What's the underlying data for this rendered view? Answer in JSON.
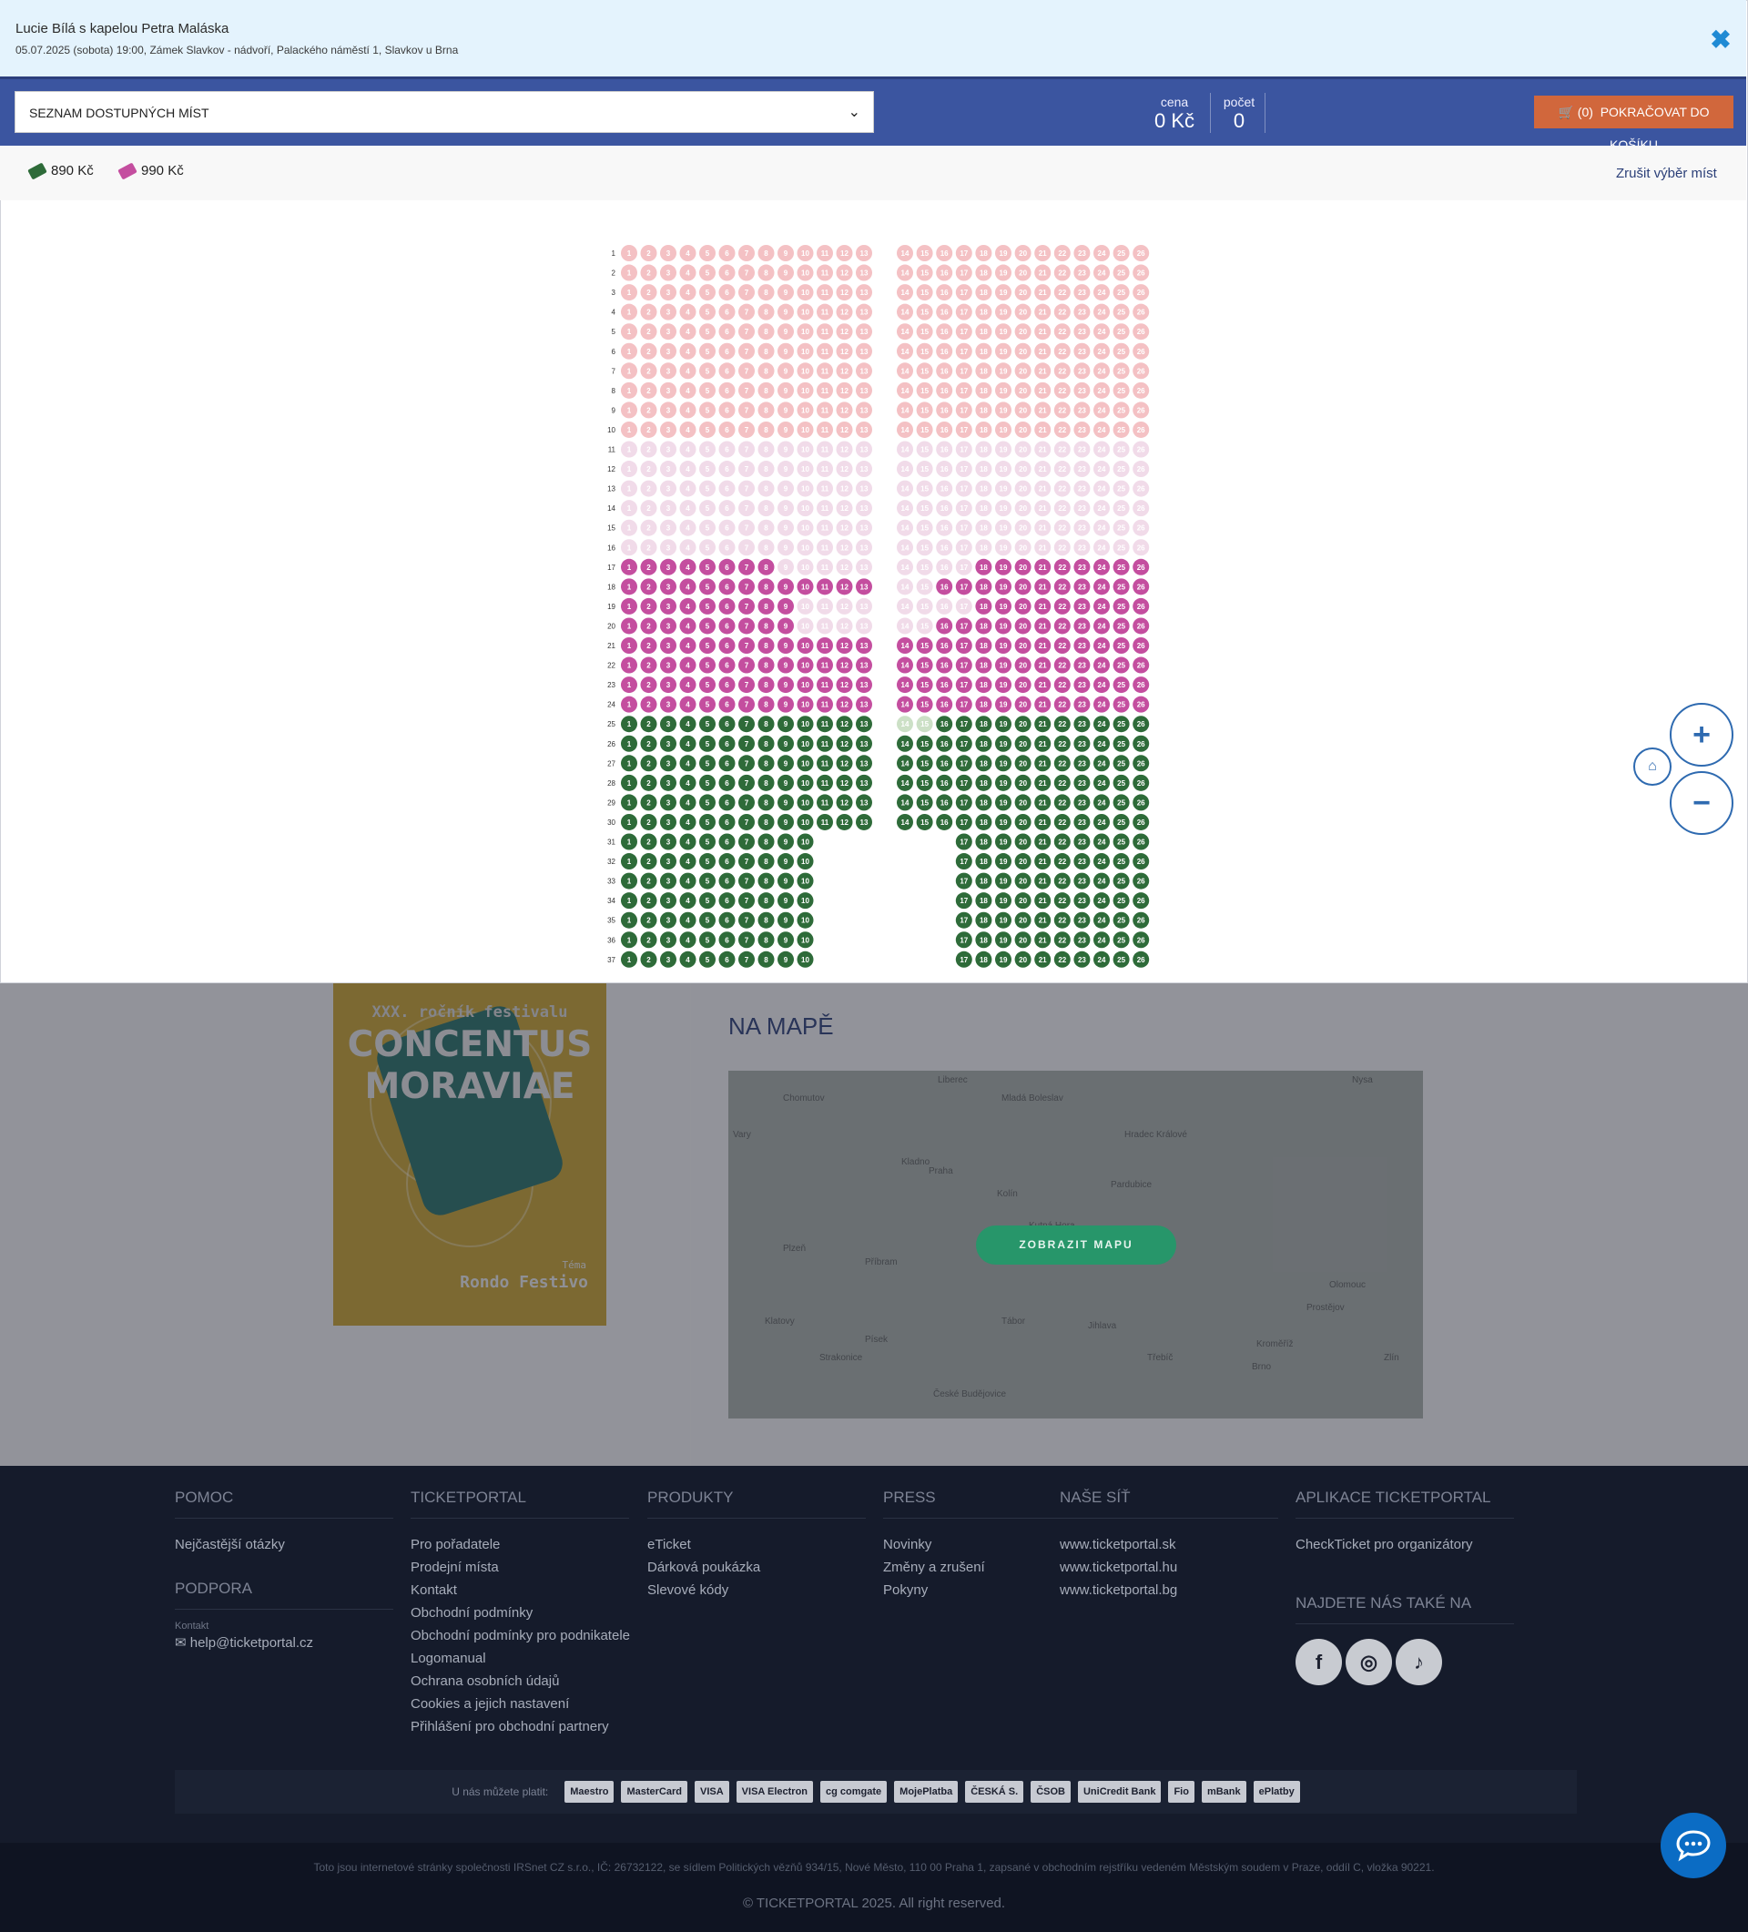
{
  "event": {
    "title": "Lucie Bílá s kapelou Petra Maláska",
    "subtitle": "05.07.2025 (sobota) 19:00, Zámek Slavkov - nádvoří, Palackého náměstí 1, Slavkov u Brna",
    "close_icon": "close-icon"
  },
  "toolbar": {
    "select_value": "SEZNAM DOSTUPNÝCH MÍST",
    "price_label": "cena",
    "price_value": "0 Kč",
    "count_label": "počet",
    "count_value": "0",
    "cart_count": "(0)",
    "cart_label": "POKRAČOVAT DO KOŠÍKU"
  },
  "legend": {
    "items": [
      {
        "label": "890 Kč",
        "color": "#2e6b39"
      },
      {
        "label": "990 Kč",
        "color": "#c44e9f"
      }
    ],
    "cancel_label": "Zrušit výběr míst"
  },
  "seat_map": {
    "rows": 37,
    "colors": {
      "sold_pink": "#f4c1c4",
      "sold_light": "#f1dbe9",
      "available_990": "#c44e9f",
      "available_890": "#2e6b39",
      "sold_green": "#cce0c6"
    }
  },
  "poster": {
    "line1": "XXX. ročník festivalu",
    "line2": "CONCENTUS",
    "line3": "MORAVIAE",
    "line4": "Téma",
    "line5": "Rondo Festivo"
  },
  "map": {
    "title": "NA MAPĚ",
    "button": "ZOBRAZIT MAPU",
    "places": [
      "Praha",
      "Plzeň",
      "Brno",
      "Mladá Boleslav",
      "Hradec Králové",
      "Pardubice",
      "Kolín",
      "Příbram",
      "Tábor",
      "Jihlava",
      "Písek",
      "Klatovy",
      "Olomouc",
      "Prostějov",
      "Třebíč",
      "Kutná Hora",
      "Kladno",
      "Liberec",
      "Nysa",
      "Chomutov",
      "Vary",
      "Strakonice",
      "České Budějovice",
      "Kroměříž",
      "Zlín"
    ]
  },
  "footer": {
    "columns": [
      {
        "heading": "POMOC",
        "links": [
          "Nejčastější otázky"
        ]
      },
      {
        "heading": "TICKETPORTAL",
        "links": [
          "Pro pořadatele",
          "Prodejní místa",
          "Kontakt",
          "Obchodní podmínky",
          "Obchodní podmínky pro podnikatele",
          "Logomanual",
          "Ochrana osobních údajů",
          "Cookies a jejich nastavení",
          "Přihlášení pro obchodní partnery"
        ]
      },
      {
        "heading": "PRODUKTY",
        "links": [
          "eTicket",
          "Dárková poukázka",
          "Slevové kódy"
        ]
      },
      {
        "heading": "PRESS",
        "links": [
          "Novinky",
          "Změny a zrušení",
          "Pokyny"
        ]
      },
      {
        "heading": "NAŠE SÍŤ",
        "links": [
          "www.ticketportal.sk",
          "www.ticketportal.hu",
          "www.ticketportal.bg"
        ]
      },
      {
        "heading": "APLIKACE TICKETPORTAL",
        "links": [
          "CheckTicket pro organizátory"
        ]
      }
    ],
    "support_heading": "PODPORA",
    "contact_label": "Kontakt",
    "contact_email": "help@ticketportal.cz",
    "social_heading": "NAJDETE NÁS TAKÉ NA",
    "social": [
      "f",
      "◎",
      "♪"
    ],
    "pay_label": "U nás můžete platit:",
    "payments": [
      "Maestro",
      "MasterCard",
      "VISA",
      "VISA Electron",
      "cg comgate",
      "MojePlatba",
      "ČESKÁ S.",
      "ČSOB",
      "UniCredit Bank",
      "Fio",
      "mBank",
      "ePlatby"
    ],
    "legal": "Toto jsou internetové stránky společnosti IRSnet CZ s.r.o., IČ: 26732122, se sídlem Politických vězňů 934/15, Nové Město, 110 00 Praha 1, zapsané v obchodním rejstříku vedeném Městským soudem v Praze, oddíl C, vložka 90221.",
    "copyright": "© TICKETPORTAL 2025. All right reserved."
  }
}
